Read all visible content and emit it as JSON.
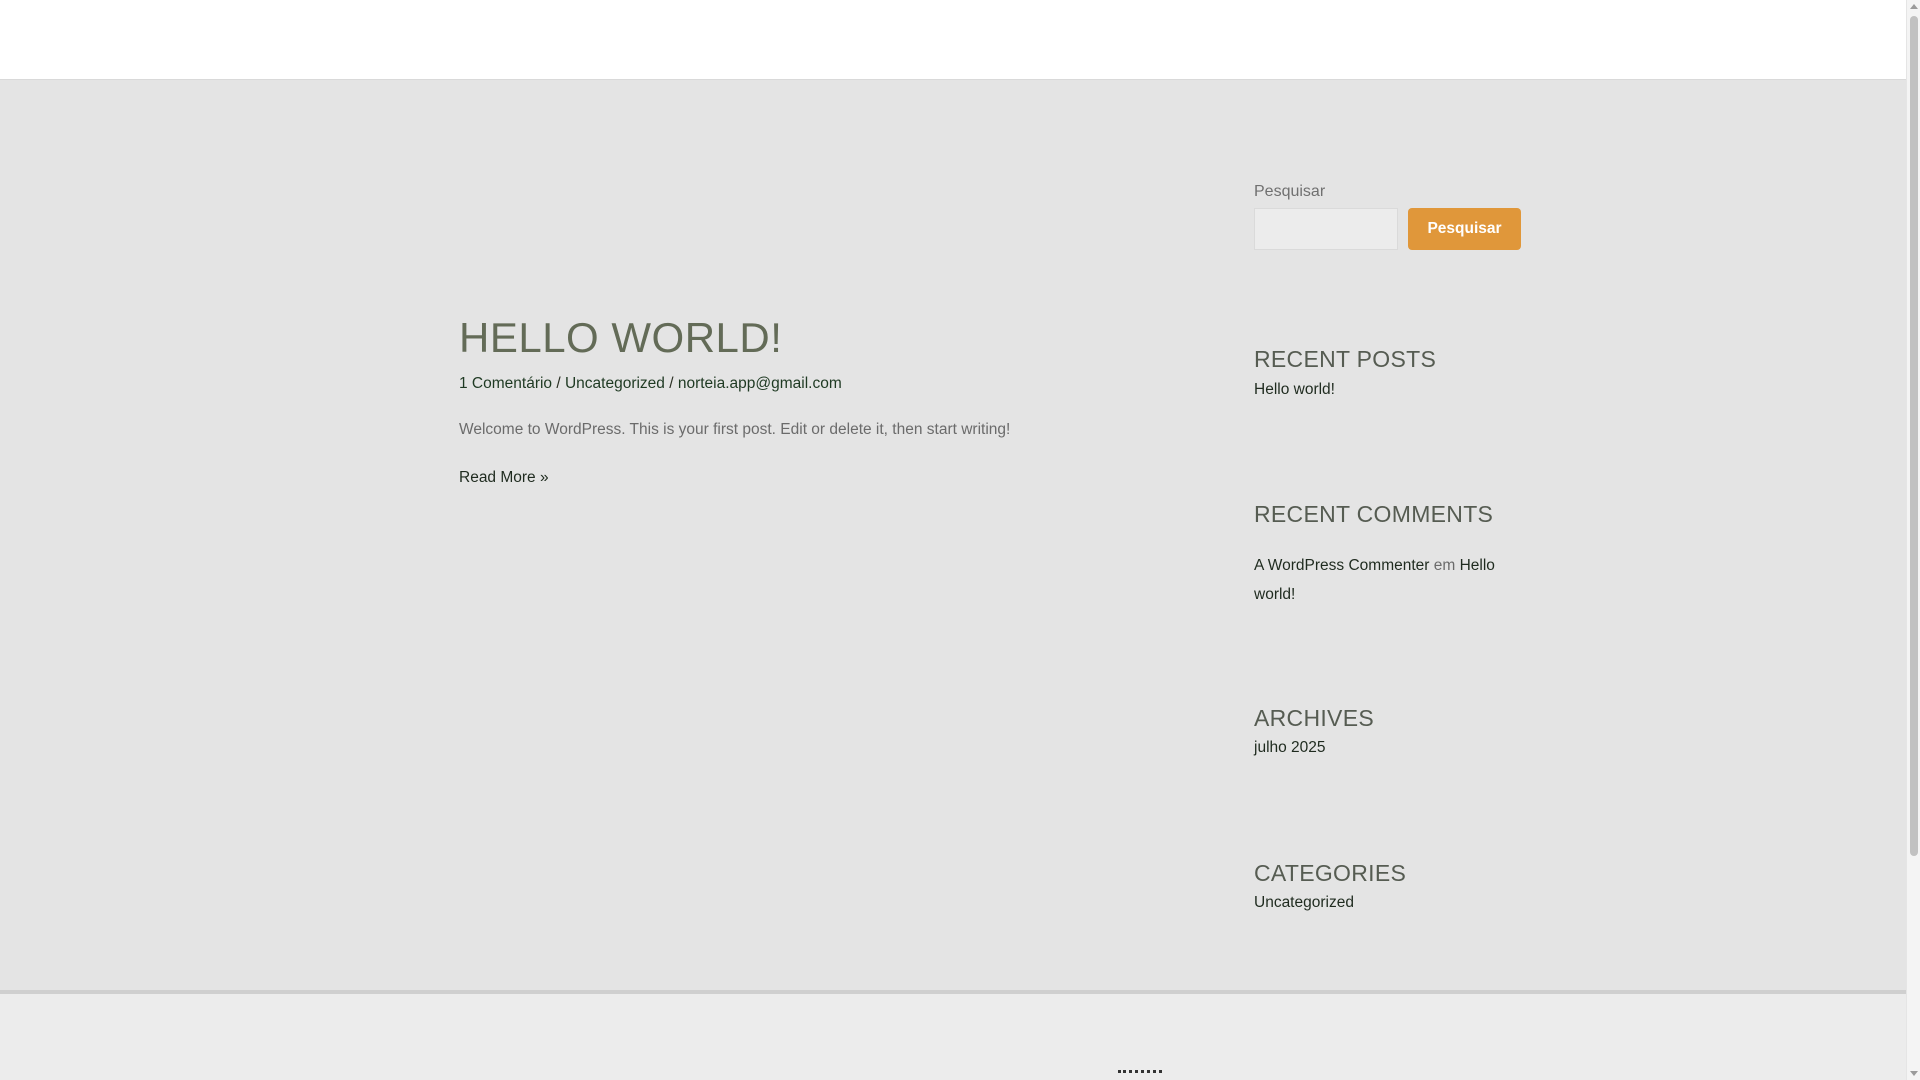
{
  "post": {
    "title": "HELLO WORLD!",
    "meta": {
      "comments": "1 Comentário",
      "separator": " / ",
      "category": "Uncategorized",
      "author": "norteia.app@gmail.com"
    },
    "excerpt": "Welcome to WordPress. This is your first post. Edit or delete it, then start writing!",
    "read_more": "Read More »"
  },
  "sidebar": {
    "search": {
      "label": "Pesquisar",
      "placeholder": "",
      "value": "",
      "button_label": "Pesquisar"
    },
    "recent_posts": {
      "title": "RECENT POSTS",
      "items": [
        "Hello world!"
      ]
    },
    "recent_comments": {
      "title": "RECENT COMMENTS",
      "author": "A WordPress Commenter",
      "connector": " em ",
      "post": "Hello world!"
    },
    "archives": {
      "title": "ARCHIVES",
      "items": [
        "julho 2025"
      ]
    },
    "categories": {
      "title": "CATEGORIES",
      "items": [
        "Uncategorized"
      ]
    }
  },
  "colors": {
    "accent": "#e0973a",
    "title": "#636b57",
    "background": "#e4e4e4"
  }
}
